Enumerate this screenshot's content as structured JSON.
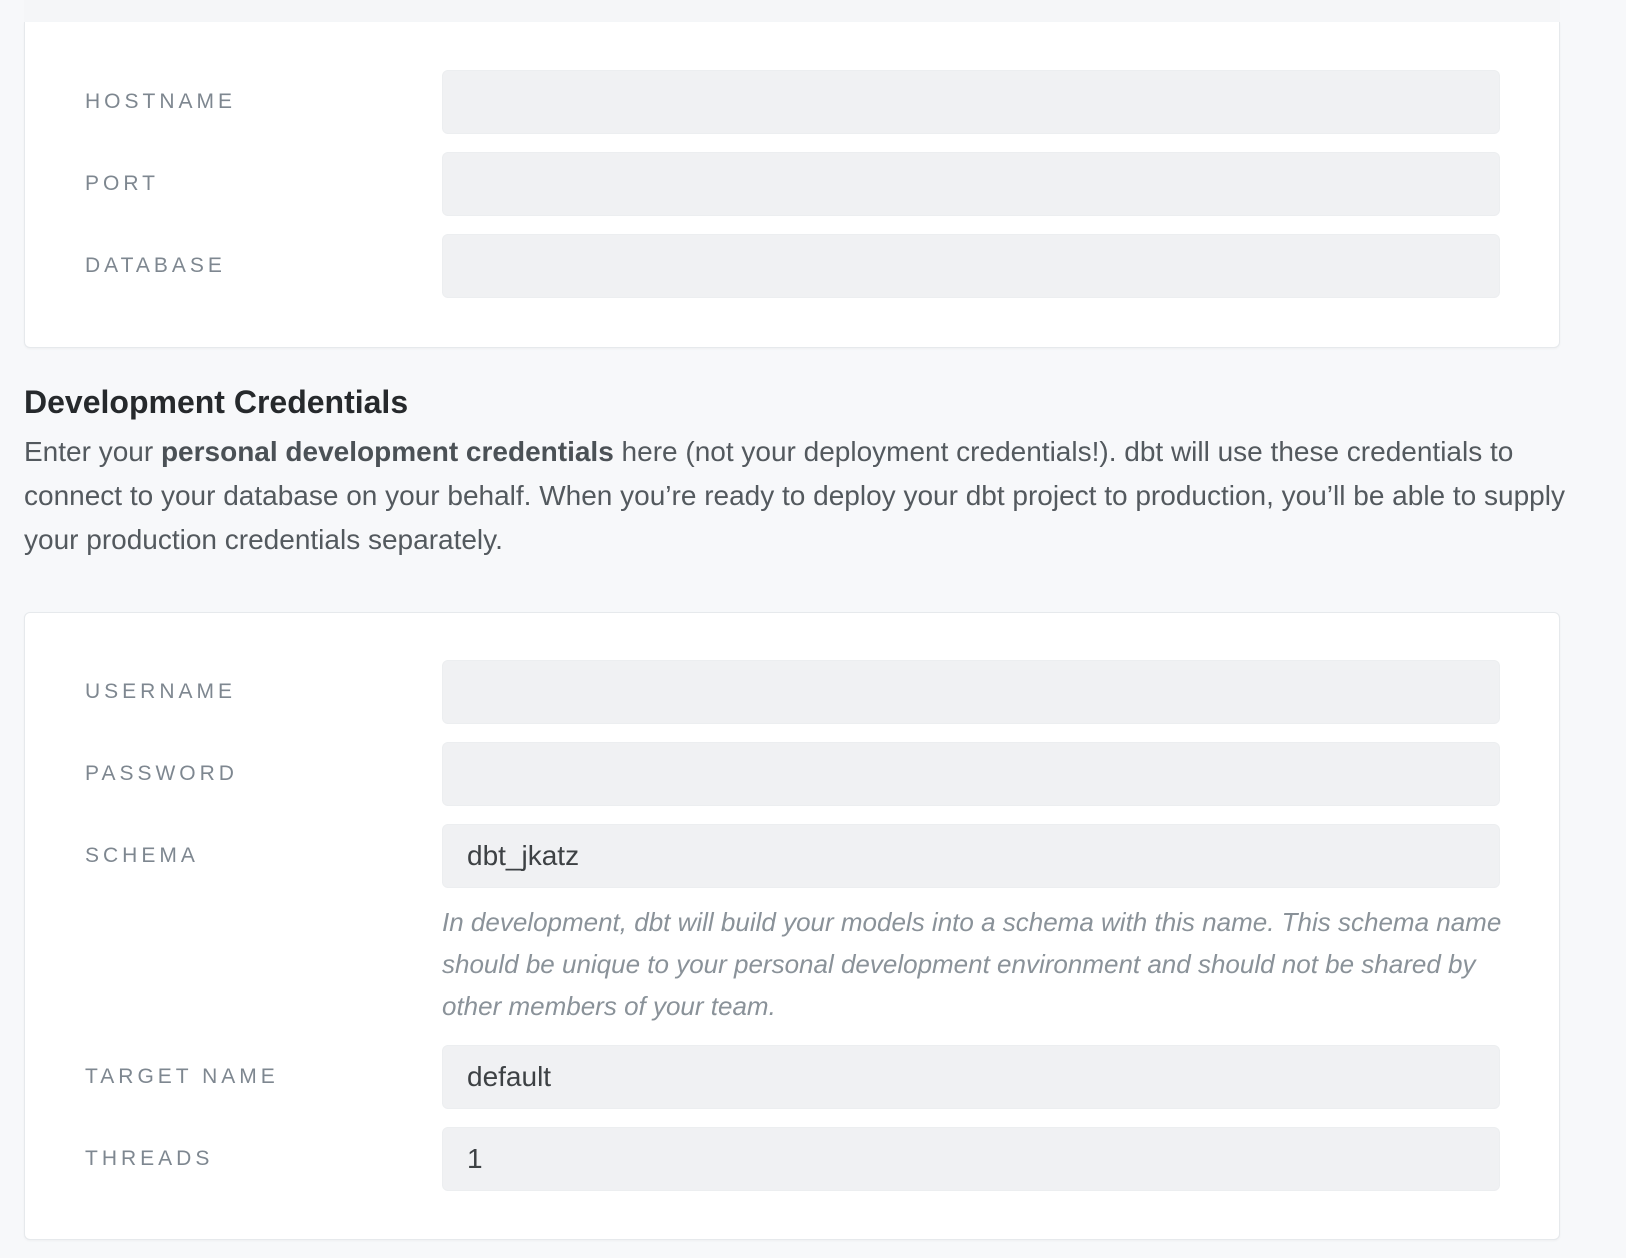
{
  "connection": {
    "fields": [
      {
        "label": "HOSTNAME",
        "value": ""
      },
      {
        "label": "PORT",
        "value": ""
      },
      {
        "label": "DATABASE",
        "value": ""
      }
    ]
  },
  "dev_credentials": {
    "title": "Development Credentials",
    "description": {
      "before": "Enter your ",
      "bold": "personal development credentials",
      "after": " here (not your deployment credentials!). dbt will use these credentials to connect to your database on your behalf. When you’re ready to deploy your dbt project to production, you’ll be able to supply your production credentials separately."
    },
    "fields": {
      "username": {
        "label": "USERNAME",
        "value": ""
      },
      "password": {
        "label": "PASSWORD",
        "value": ""
      },
      "schema": {
        "label": "SCHEMA",
        "value": "dbt_jkatz",
        "help": "In development, dbt will build your models into a schema with this name. This schema name should be unique to your personal development environment and should not be shared by other members of your team."
      },
      "target_name": {
        "label": "TARGET NAME",
        "value": "default"
      },
      "threads": {
        "label": "THREADS",
        "value": "1"
      }
    }
  }
}
